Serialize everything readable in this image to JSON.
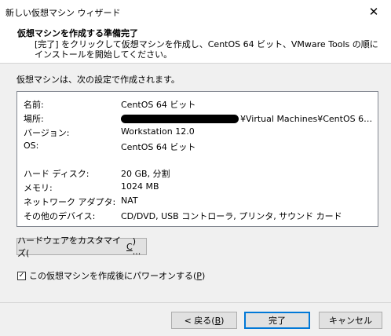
{
  "window": {
    "title": "新しい仮想マシン ウィザード",
    "close_glyph": "✕"
  },
  "header": {
    "title": "仮想マシンを作成する準備完了",
    "description": "[完了] をクリックして仮想マシンを作成し、CentOS 64 ビット、VMware Tools の順にインストールを開始してください。"
  },
  "summary": {
    "intro": "仮想マシンは、次の設定で作成されます。",
    "rows": [
      {
        "key": "名前:",
        "value": "CentOS 64 ビット"
      },
      {
        "key": "場所:",
        "value": "¥Virtual Machines¥CentOS 64 ビ..."
      },
      {
        "key": "バージョン:",
        "value": "Workstation 12.0"
      },
      {
        "key": "OS:",
        "value": "CentOS 64 ビット"
      },
      {
        "key": "ハード ディスク:",
        "value": "20 GB, 分割"
      },
      {
        "key": "メモリ:",
        "value": "1024 MB"
      },
      {
        "key": "ネットワーク アダプタ:",
        "value": "NAT"
      },
      {
        "key": "その他のデバイス:",
        "value": "CD/DVD, USB コントローラ, プリンタ, サウンド カード"
      }
    ]
  },
  "customize": {
    "pre": "ハードウェアをカスタマイズ(",
    "key": "C",
    "post": ") ..."
  },
  "power_on": {
    "checked": true,
    "check_glyph": "✓",
    "pre": "この仮想マシンを作成後にパワーオンする(",
    "key": "P",
    "post": ")"
  },
  "buttons": {
    "back": {
      "pre": "< 戻る(",
      "key": "B",
      "post": ")"
    },
    "finish": "完了",
    "cancel": "キャンセル"
  }
}
